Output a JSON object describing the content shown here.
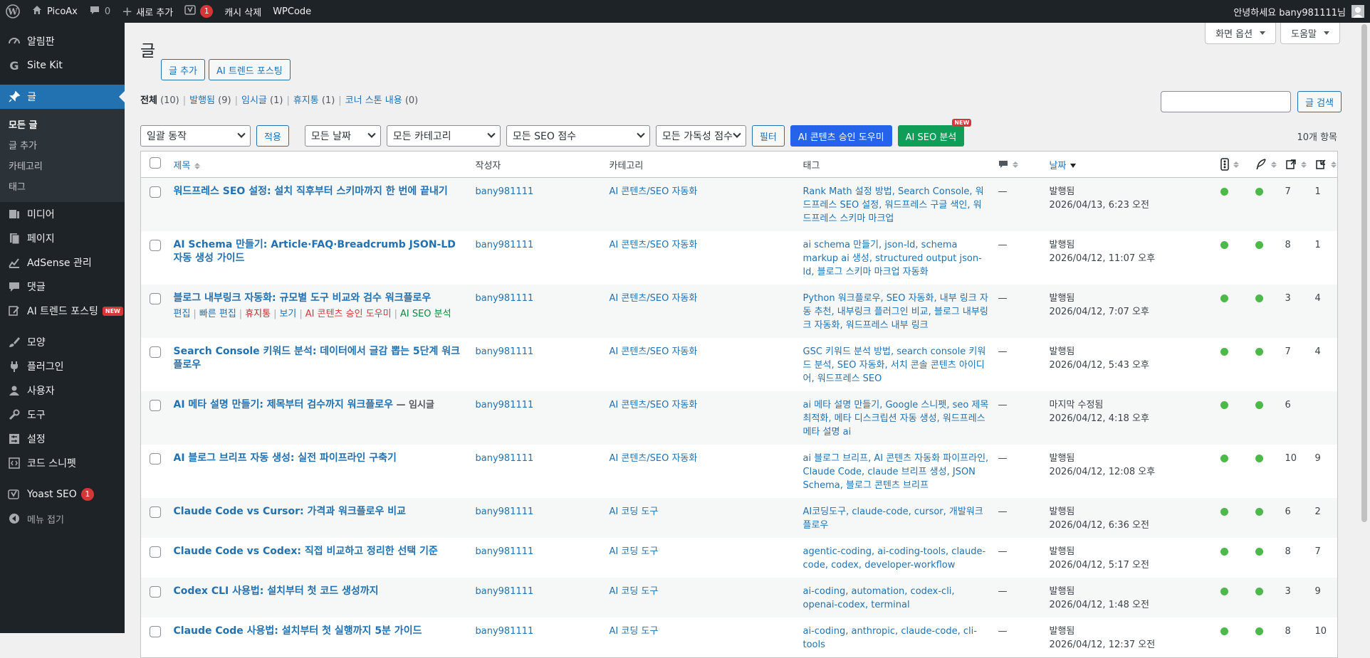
{
  "adminbar": {
    "site_name": "PicoAx",
    "comments_count": "0",
    "new_label": "새로 추가",
    "yoast_count": "1",
    "clear_cache": "캐시 삭제",
    "wpcode": "WPCode",
    "greeting": "안녕하세요 bany981111님"
  },
  "sidebar": {
    "items": [
      {
        "label": "알림판",
        "icon": "dashboard-icon"
      },
      {
        "label": "Site Kit",
        "icon": "google-g-icon"
      },
      {
        "label": "글",
        "icon": "pin-icon"
      },
      {
        "label": "미디어",
        "icon": "media-icon"
      },
      {
        "label": "페이지",
        "icon": "page-icon"
      },
      {
        "label": "AdSense 관리",
        "icon": "chart-icon"
      },
      {
        "label": "댓글",
        "icon": "comment-icon"
      },
      {
        "label": "AI 트렌드 포스팅",
        "icon": "edit-icon",
        "badge": "NEW"
      },
      {
        "label": "모양",
        "icon": "brush-icon"
      },
      {
        "label": "플러그인",
        "icon": "plug-icon"
      },
      {
        "label": "사용자",
        "icon": "user-icon"
      },
      {
        "label": "도구",
        "icon": "wrench-icon"
      },
      {
        "label": "설정",
        "icon": "settings-icon"
      },
      {
        "label": "코드 스니펫",
        "icon": "code-icon"
      },
      {
        "label": "Yoast SEO",
        "icon": "yoast-icon",
        "count": "1"
      },
      {
        "label": "메뉴 접기",
        "icon": "collapse-icon"
      }
    ],
    "submenu": [
      "모든 글",
      "글 추가",
      "카테고리",
      "태그"
    ]
  },
  "screen_options": "화면 옵션",
  "help": "도움말",
  "page": {
    "title": "글",
    "add_new": "글 추가",
    "ai_trend": "AI 트렌드 포스팅"
  },
  "filters": {
    "all": {
      "label": "전체",
      "count": "(10)"
    },
    "published": {
      "label": "발행됨",
      "count": "(9)"
    },
    "draft": {
      "label": "임시글",
      "count": "(1)"
    },
    "trash": {
      "label": "휴지통",
      "count": "(1)"
    },
    "cornerstone": {
      "label": "코너 스톤 내용",
      "count": "(0)"
    }
  },
  "search": {
    "button": "글 검색",
    "value": ""
  },
  "tablenav": {
    "bulk_action": "일괄 동작",
    "apply": "적용",
    "all_dates": "모든 날짜",
    "all_categories": "모든 카테고리",
    "all_seo": "모든 SEO 점수",
    "all_readability": "모든 가독성 점수",
    "filter": "필터",
    "ai_approve": "AI 콘텐츠 승인 도우미",
    "ai_seo": "AI SEO 분석",
    "new_tag": "NEW",
    "items_count": "10개 항목"
  },
  "columns": {
    "title": "제목",
    "author": "작성자",
    "categories": "카테고리",
    "tags": "태그",
    "date": "날짜"
  },
  "colors": {
    "seo_good": "#4cb948",
    "primary": "#2271b1",
    "menu_bg": "#1d2327"
  },
  "row_actions": {
    "edit": "편집",
    "quick_edit": "빠른 편집",
    "trash": "휴지통",
    "view": "보기",
    "ai_approve": "AI 콘텐츠 승인 도우미",
    "ai_seo": "AI SEO 분석"
  },
  "posts": [
    {
      "title": "워드프레스 SEO 설정: 설치 직후부터 스키마까지 한 번에 끝내기",
      "state": "",
      "author": "bany981111",
      "category": "AI 콘텐츠/SEO 자동화",
      "tags": "Rank Math 설정 방법, Search Console, 워드프레스 SEO 설정, 워드프레스 구글 색인, 워드프레스 스키마 마크업",
      "comments": "—",
      "status": "발행됨",
      "date": "2026/04/13, 6:23 오전",
      "links_out": "7",
      "links_in": "1",
      "show_actions": false
    },
    {
      "title": "AI Schema 만들기: Article·FAQ·Breadcrumb JSON-LD 자동 생성 가이드",
      "state": "",
      "author": "bany981111",
      "category": "AI 콘텐츠/SEO 자동화",
      "tags": "ai schema 만들기, json-ld, schema markup ai 생성, structured output json-ld, 블로그 스키마 마크업 자동화",
      "comments": "—",
      "status": "발행됨",
      "date": "2026/04/12, 11:07 오후",
      "links_out": "8",
      "links_in": "1",
      "show_actions": false
    },
    {
      "title": "블로그 내부링크 자동화: 규모별 도구 비교와 검수 워크플로우",
      "state": "",
      "author": "bany981111",
      "category": "AI 콘텐츠/SEO 자동화",
      "tags": "Python 워크플로우, SEO 자동화, 내부 링크 자동 추천, 내부링크 플러그인 비교, 블로그 내부링크 자동화, 워드프레스 내부 링크",
      "comments": "—",
      "status": "발행됨",
      "date": "2026/04/12, 7:07 오후",
      "links_out": "3",
      "links_in": "4",
      "show_actions": true
    },
    {
      "title": "Search Console 키워드 분석: 데이터에서 글감 뽑는 5단계 워크플로우",
      "state": "",
      "author": "bany981111",
      "category": "AI 콘텐츠/SEO 자동화",
      "tags": "GSC 키워드 분석 방법, search console 키워드 분석, SEO 자동화, 서치 콘솔 콘텐츠 아이디어, 워드프레스 SEO",
      "comments": "—",
      "status": "발행됨",
      "date": "2026/04/12, 5:43 오후",
      "links_out": "7",
      "links_in": "4",
      "show_actions": false
    },
    {
      "title": "AI 메타 설명 만들기: 제목부터 검수까지 워크플로우",
      "state": " — 임시글",
      "author": "bany981111",
      "category": "AI 콘텐츠/SEO 자동화",
      "tags": "ai 메타 설명 만들기, Google 스니펫, seo 제목 최적화, 메타 디스크립션 자동 생성, 워드프레스 메타 설명 ai",
      "comments": "—",
      "status": "마지막 수정됨",
      "date": "2026/04/12, 4:18 오후",
      "links_out": "6",
      "links_in": "",
      "show_actions": false
    },
    {
      "title": "AI 블로그 브리프 자동 생성: 실전 파이프라인 구축기",
      "state": "",
      "author": "bany981111",
      "category": "AI 콘텐츠/SEO 자동화",
      "tags": "ai 블로그 브리프, AI 콘텐츠 자동화 파이프라인, Claude Code, claude 브리프 생성, JSON Schema, 블로그 콘텐츠 브리프",
      "comments": "—",
      "status": "발행됨",
      "date": "2026/04/12, 12:08 오후",
      "links_out": "10",
      "links_in": "9",
      "show_actions": false
    },
    {
      "title": "Claude Code vs Cursor: 가격과 워크플로우 비교",
      "state": "",
      "author": "bany981111",
      "category": "AI 코딩 도구",
      "tags": "AI코딩도구, claude-code, cursor, 개발워크플로우",
      "comments": "—",
      "status": "발행됨",
      "date": "2026/04/12, 6:36 오전",
      "links_out": "6",
      "links_in": "2",
      "show_actions": false
    },
    {
      "title": "Claude Code vs Codex: 직접 비교하고 정리한 선택 기준",
      "state": "",
      "author": "bany981111",
      "category": "AI 코딩 도구",
      "tags": "agentic-coding, ai-coding-tools, claude-code, codex, developer-workflow",
      "comments": "—",
      "status": "발행됨",
      "date": "2026/04/12, 5:17 오전",
      "links_out": "8",
      "links_in": "7",
      "show_actions": false
    },
    {
      "title": "Codex CLI 사용법: 설치부터 첫 코드 생성까지",
      "state": "",
      "author": "bany981111",
      "category": "AI 코딩 도구",
      "tags": "ai-coding, automation, codex-cli, openai-codex, terminal",
      "comments": "—",
      "status": "발행됨",
      "date": "2026/04/12, 1:48 오전",
      "links_out": "3",
      "links_in": "9",
      "show_actions": false
    },
    {
      "title": "Claude Code 사용법: 설치부터 첫 실행까지 5분 가이드",
      "state": "",
      "author": "bany981111",
      "category": "AI 코딩 도구",
      "tags": "ai-coding, anthropic, claude-code, cli-tools",
      "comments": "—",
      "status": "발행됨",
      "date": "2026/04/12, 12:37 오전",
      "links_out": "8",
      "links_in": "10",
      "show_actions": false
    }
  ]
}
